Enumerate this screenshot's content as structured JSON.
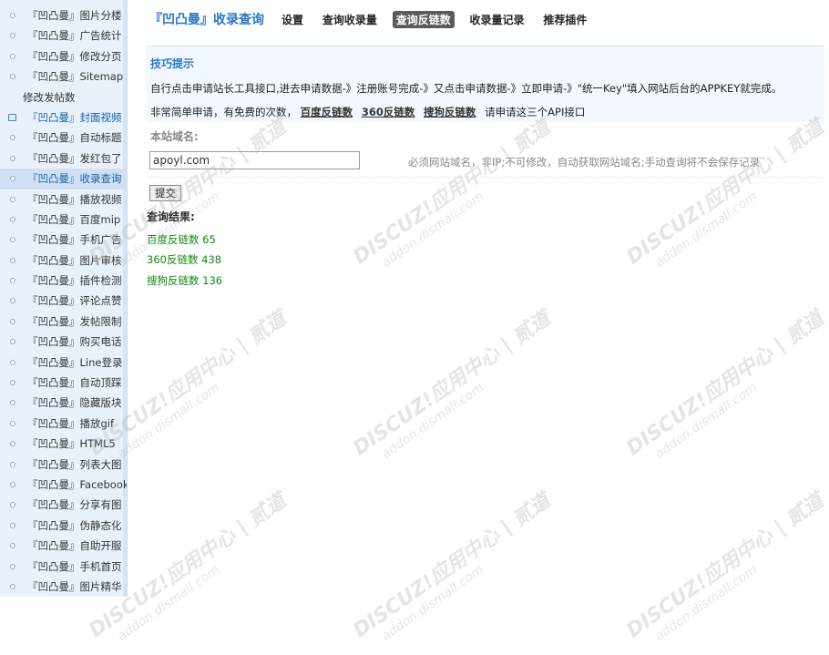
{
  "sidebar": {
    "items": [
      {
        "label": "『凹凸曼』图片分楼",
        "style": ""
      },
      {
        "label": "『凹凸曼』广告统计",
        "style": ""
      },
      {
        "label": "『凹凸曼』修改分页",
        "style": ""
      },
      {
        "label": "『凹凸曼』Sitemap",
        "style": ""
      },
      {
        "label": "修改发帖数",
        "style": "noicon"
      },
      {
        "label": "『凹凸曼』封面视频",
        "style": "sq hl"
      },
      {
        "label": "『凹凸曼』自动标题",
        "style": ""
      },
      {
        "label": "『凹凸曼』发红包了",
        "style": ""
      },
      {
        "label": "『凹凸曼』收录查询",
        "style": "active"
      },
      {
        "label": "『凹凸曼』播放视频",
        "style": ""
      },
      {
        "label": "『凹凸曼』百度mip",
        "style": ""
      },
      {
        "label": "『凹凸曼』手机广告",
        "style": ""
      },
      {
        "label": "『凹凸曼』图片审核",
        "style": ""
      },
      {
        "label": "『凹凸曼』插件检测",
        "style": ""
      },
      {
        "label": "『凹凸曼』评论点赞",
        "style": ""
      },
      {
        "label": "『凹凸曼』发帖限制",
        "style": ""
      },
      {
        "label": "『凹凸曼』购买电话",
        "style": ""
      },
      {
        "label": "『凹凸曼』Line登录",
        "style": ""
      },
      {
        "label": "『凹凸曼』自动顶踩",
        "style": ""
      },
      {
        "label": "『凹凸曼』隐藏版块",
        "style": ""
      },
      {
        "label": "『凹凸曼』播放gif",
        "style": ""
      },
      {
        "label": "『凹凸曼』HTML5",
        "style": ""
      },
      {
        "label": "『凹凸曼』列表大图",
        "style": ""
      },
      {
        "label": "『凹凸曼』Facebook",
        "style": ""
      },
      {
        "label": "『凹凸曼』分享有图",
        "style": ""
      },
      {
        "label": "『凹凸曼』伪静态化",
        "style": ""
      },
      {
        "label": "『凹凸曼』自助开服",
        "style": ""
      },
      {
        "label": "『凹凸曼』手机首页",
        "style": ""
      },
      {
        "label": "『凹凸曼』图片精华",
        "style": ""
      }
    ]
  },
  "header": {
    "title": "『凹凸曼』收录查询",
    "tabs": [
      {
        "label": "设置",
        "active": false
      },
      {
        "label": "查询收录量",
        "active": false
      },
      {
        "label": "查询反链数",
        "active": true
      },
      {
        "label": "收录量记录",
        "active": false
      },
      {
        "label": "推荐插件",
        "active": false
      }
    ]
  },
  "tips": {
    "title": "技巧提示",
    "line1": "自行点击申请站长工具接口,进去申请数据-》注册账号完成-》又点击申请数据-》立即申请-》\"统一Key\"填入网站后台的APPKEY就完成。",
    "line2_prefix": "非常简单申请，有免费的次数，",
    "line2_links": [
      "百度反链数",
      "360反链数",
      "搜狗反链数"
    ],
    "line2_suffix": "请申请这三个API接口"
  },
  "form": {
    "domain_label": "本站域名:",
    "domain_value": "apoyl.com",
    "domain_hint": "必须网站域名，非IP;不可修改，自动获取网站域名;手动查询将不会保存记录",
    "submit_label": "提交"
  },
  "results": {
    "title": "查询结果:",
    "items": [
      "百度反链数 65",
      "360反链数 438",
      "搜狗反链数 136"
    ]
  },
  "watermark": {
    "brand": "DISCUZ!应用中心 | 贰道",
    "url": "addon.dismall.com"
  }
}
